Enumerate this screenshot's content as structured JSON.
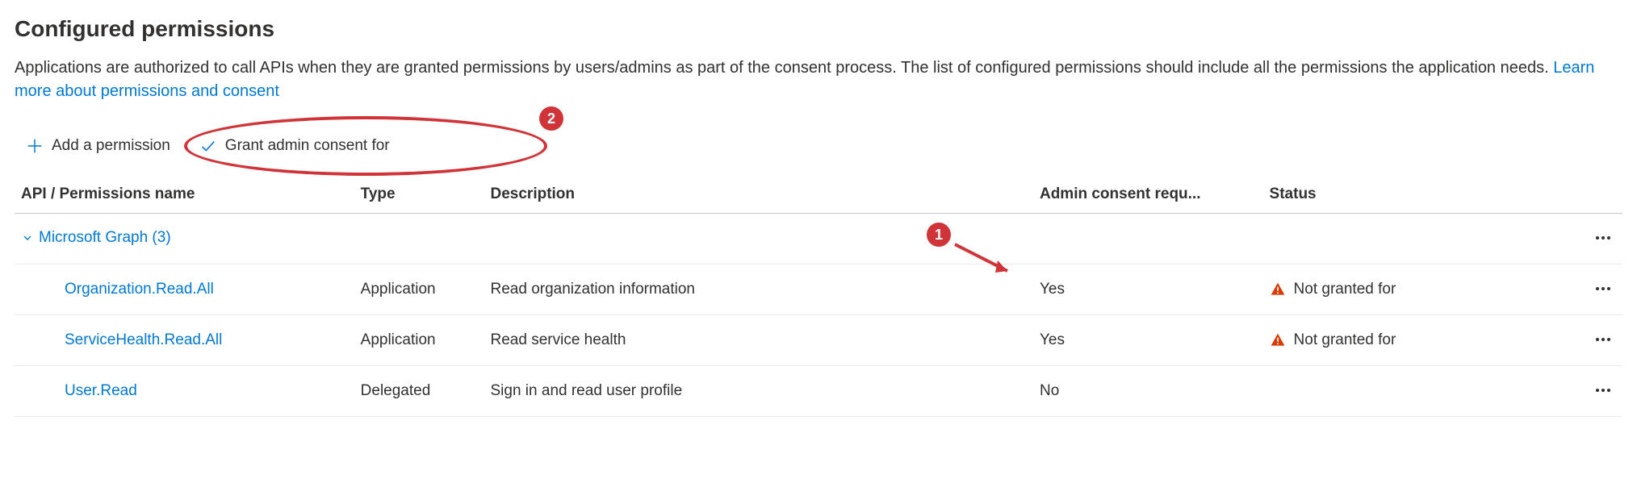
{
  "heading": "Configured permissions",
  "intro_text": "Applications are authorized to call APIs when they are granted permissions by users/admins as part of the consent process. The list of configured permissions should include all the permissions the application needs. ",
  "intro_link": "Learn more about permissions and consent",
  "toolbar": {
    "add_label": "Add a permission",
    "grant_label": "Grant admin consent for"
  },
  "annotations": {
    "badge2": "2",
    "badge1": "1"
  },
  "columns": {
    "name": "API / Permissions name",
    "type": "Type",
    "description": "Description",
    "consent": "Admin consent requ...",
    "status": "Status"
  },
  "group": {
    "label": "Microsoft Graph (3)"
  },
  "rows": [
    {
      "name": "Organization.Read.All",
      "type": "Application",
      "description": "Read organization information",
      "consent": "Yes",
      "status": "Not granted for",
      "warn": true
    },
    {
      "name": "ServiceHealth.Read.All",
      "type": "Application",
      "description": "Read service health",
      "consent": "Yes",
      "status": "Not granted for",
      "warn": true
    },
    {
      "name": "User.Read",
      "type": "Delegated",
      "description": "Sign in and read user profile",
      "consent": "No",
      "status": "",
      "warn": false
    }
  ]
}
